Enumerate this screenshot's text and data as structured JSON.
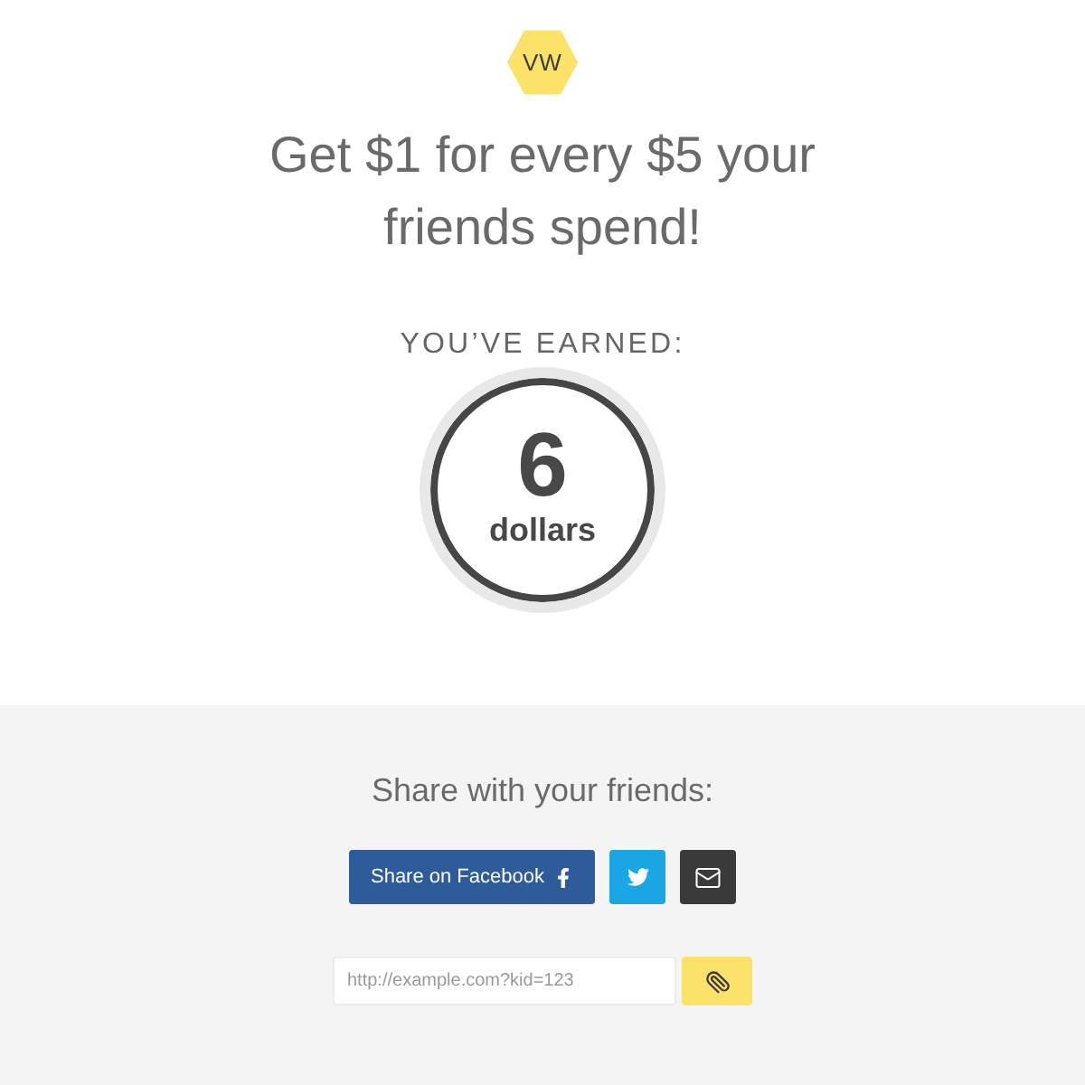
{
  "logo": {
    "text": "VW"
  },
  "headline": "Get $1 for every $5 your friends spend!",
  "earnings": {
    "label": "YOU’VE EARNED:",
    "amount": "6",
    "unit": "dollars"
  },
  "share": {
    "title": "Share with your friends:",
    "buttons": [
      {
        "kind": "facebook",
        "label": "Share on Facebook"
      },
      {
        "kind": "twitter"
      },
      {
        "kind": "email"
      }
    ],
    "link": {
      "value": "http://example.com?kid=123"
    }
  }
}
